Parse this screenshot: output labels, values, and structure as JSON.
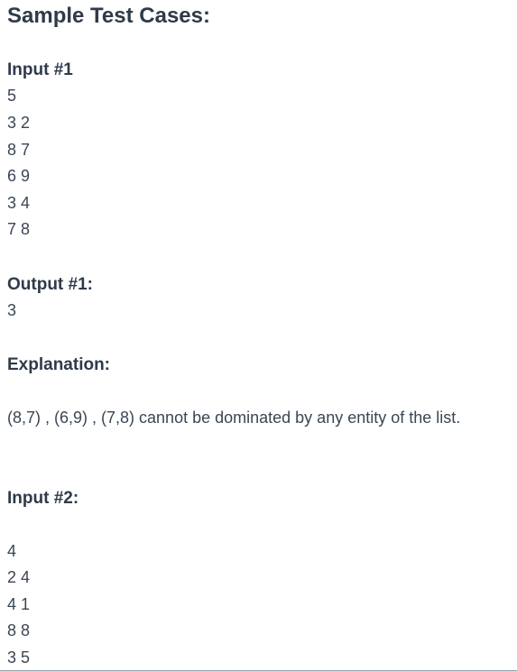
{
  "title": "Sample Test Cases:",
  "input1": {
    "heading": "Input #1",
    "lines": [
      "5",
      "3 2",
      "8 7",
      "6 9",
      "3 4",
      "7 8"
    ]
  },
  "output1": {
    "heading": "Output #1:",
    "lines": [
      "3"
    ]
  },
  "explanation": {
    "heading": "Explanation:",
    "text": "(8,7) , (6,9) , (7,8) cannot be dominated by any entity of the list."
  },
  "input2": {
    "heading": "Input #2:",
    "lines": [
      "4",
      "2 4",
      "4 1",
      "8 8",
      "3 5"
    ]
  }
}
